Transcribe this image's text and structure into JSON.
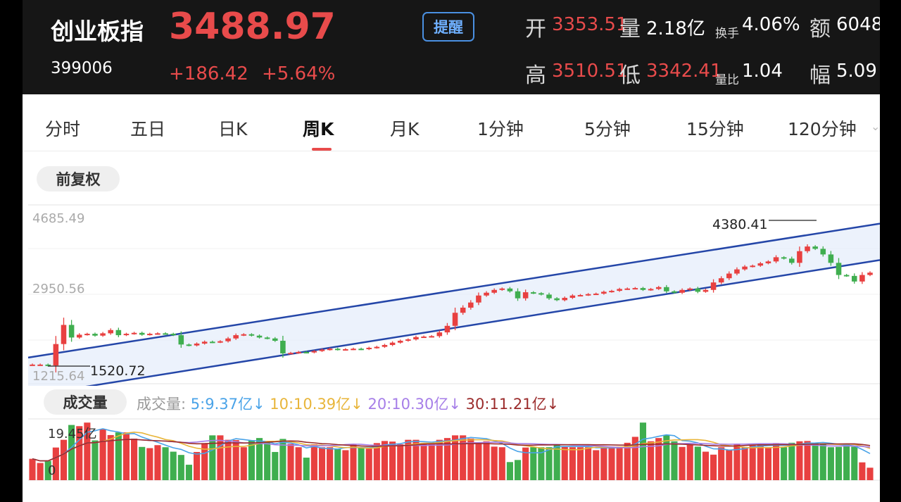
{
  "header": {
    "index_name": "创业板指",
    "index_code": "399006",
    "price": "3488.97",
    "change": "+186.42",
    "change_pct": "+5.64%",
    "remind_label": "提醒",
    "stats": {
      "open_label": "开",
      "open_value": "3353.51",
      "volume_label": "量",
      "volume_value": "2.18亿",
      "turnover_label": "换手",
      "turnover_value": "4.06%",
      "amount_label": "额",
      "amount_value": "6048",
      "high_label": "高",
      "high_value": "3510.51",
      "low_label": "低",
      "low_value": "3342.41",
      "vol_ratio_label": "量比",
      "vol_ratio_value": "1.04",
      "amplitude_label": "幅",
      "amplitude_value": "5.09"
    }
  },
  "tabs": [
    "分时",
    "五日",
    "日K",
    "周K",
    "月K",
    "1分钟",
    "5分钟",
    "15分钟",
    "120分钟"
  ],
  "active_tab": "周K",
  "adjust_label": "前复权",
  "price_axis": {
    "top": "4685.49",
    "mid": "2950.56",
    "bottom": "1215.64"
  },
  "annotations": {
    "max": "4380.41",
    "min": "1520.72"
  },
  "volume_panel": {
    "title": "成交量",
    "legend": [
      {
        "label": "成交量:",
        "color": "#999999"
      },
      {
        "label": "5:9.37亿↓",
        "color": "#4aa3e8"
      },
      {
        "label": "10:10.39亿↓",
        "color": "#e8b53a"
      },
      {
        "label": "20:10.30亿↓",
        "color": "#a67ee8"
      },
      {
        "label": "30:11.21亿↓",
        "color": "#9b2b2b"
      }
    ],
    "axis_top": "19.45亿",
    "axis_bottom": "0"
  },
  "colors": {
    "up": "#e84040",
    "down": "#3fae4f",
    "channel": "#2446a8",
    "accent": "#e84b4b"
  },
  "chart_data": {
    "type": "candlestick",
    "y_axis_labels": [
      "4685.49",
      "2950.56",
      "1215.64"
    ],
    "ylim": [
      1215.64,
      4685.49
    ],
    "max_label": "4380.41",
    "min_label": "1520.72",
    "closes": [
      1520,
      1520,
      1500,
      1960,
      2370,
      2100,
      2160,
      2180,
      2140,
      2190,
      2260,
      2150,
      2180,
      2200,
      2160,
      2180,
      2190,
      2180,
      2150,
      1950,
      1930,
      1970,
      2010,
      2000,
      2020,
      2080,
      2150,
      2170,
      2140,
      2100,
      2080,
      2030,
      1760,
      1770,
      1790,
      1780,
      1810,
      1840,
      1860,
      1840,
      1850,
      1860,
      1850,
      1880,
      1900,
      1940,
      1990,
      2030,
      2060,
      2110,
      2120,
      2130,
      2210,
      2350,
      2630,
      2740,
      2850,
      3000,
      3060,
      3120,
      3150,
      3090,
      2940,
      3070,
      3050,
      3020,
      2940,
      2900,
      2950,
      3000,
      3010,
      3030,
      3040,
      3080,
      3100,
      3140,
      3150,
      3160,
      3120,
      3140,
      3180,
      3090,
      3060,
      3120,
      3150,
      3080,
      3120,
      3280,
      3370,
      3470,
      3560,
      3620,
      3640,
      3690,
      3730,
      3820,
      3790,
      3700,
      3950,
      4050,
      4000,
      3880,
      3700,
      3440,
      3420,
      3300,
      3440,
      3490
    ],
    "volumes": [
      7.2,
      5.8,
      6.5,
      11.0,
      13.6,
      18.6,
      18.2,
      19.4,
      13.4,
      17.1,
      15.2,
      16.1,
      16.1,
      14.0,
      11.2,
      10.8,
      11.8,
      11.1,
      9.6,
      8.5,
      5.2,
      9.5,
      12.5,
      15.1,
      15.1,
      13.6,
      13.5,
      11.1,
      13.5,
      14.2,
      12.8,
      9.5,
      13.9,
      12.2,
      11.1,
      7.6,
      12.1,
      11.1,
      11.1,
      10.5,
      10.1,
      12.1,
      11.1,
      10.6,
      12.5,
      13.2,
      13.0,
      12.1,
      13.6,
      13.6,
      12.6,
      12.1,
      13.6,
      14.2,
      15.1,
      15.1,
      14.0,
      12.5,
      13.1,
      11.3,
      11.1,
      6.1,
      6.8,
      11.0,
      11.1,
      11.1,
      11.1,
      12.1,
      11.3,
      11.1,
      11.1,
      11.1,
      10.1,
      11.1,
      11.1,
      11.3,
      12.6,
      14.6,
      19.4,
      13.1,
      14.2,
      15.1,
      13.1,
      11.2,
      12.1,
      11.3,
      9.6,
      8.6,
      11.1,
      10.1,
      12.1,
      11.1,
      11.9,
      12.1,
      11.1,
      12.5,
      11.1,
      12.6,
      13.1,
      13.2,
      12.6,
      12.1,
      11.1,
      11.2,
      12.1,
      11.3,
      6.0,
      4.2
    ],
    "channel": {
      "upper": {
        "x": [
          0,
          107
        ],
        "y": [
          1670,
          4540
        ]
      },
      "lower": {
        "x": [
          0,
          107
        ],
        "y": [
          850,
          3760
        ]
      }
    },
    "moving_averages": [
      "MA5",
      "MA10",
      "MA20",
      "MA30"
    ]
  }
}
